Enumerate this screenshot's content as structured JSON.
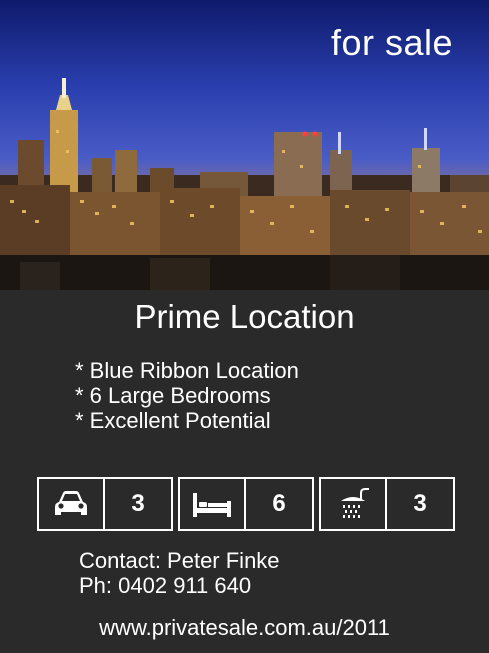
{
  "hero": {
    "badge": "for sale"
  },
  "listing": {
    "headline": "Prime Location",
    "features": [
      "* Blue Ribbon Location",
      "* 6 Large Bedrooms",
      "* Excellent Potential"
    ],
    "stats": [
      {
        "icon": "car-icon",
        "value": "3"
      },
      {
        "icon": "bed-icon",
        "value": "6"
      },
      {
        "icon": "shower-icon",
        "value": "3"
      }
    ]
  },
  "contact": {
    "name_line": "Contact: Peter Finke",
    "phone_line": "Ph: 0402 911 640",
    "website": "www.privatesale.com.au/2011"
  }
}
